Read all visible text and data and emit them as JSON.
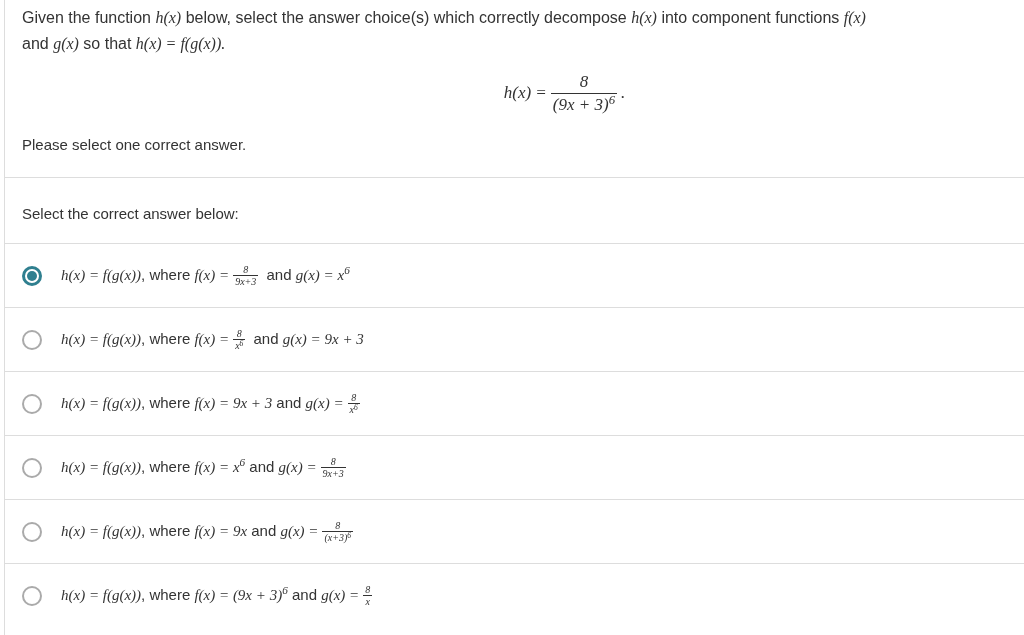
{
  "question": {
    "parts": [
      {
        "kind": "text",
        "text": "Given the function "
      },
      {
        "kind": "math",
        "text": "h(x)"
      },
      {
        "kind": "text",
        "text": " below, select the answer choice(s) which correctly decompose "
      },
      {
        "kind": "math",
        "text": "h(x)"
      },
      {
        "kind": "text",
        "text": " into component functions "
      },
      {
        "kind": "math",
        "text": "f(x)"
      },
      {
        "kind": "text",
        "text": " and "
      },
      {
        "kind": "math",
        "text": "g(x)"
      },
      {
        "kind": "text",
        "text": " so that "
      },
      {
        "kind": "math",
        "text": "h(x) = f(g(x))."
      }
    ]
  },
  "formula": {
    "parts": [
      {
        "kind": "math",
        "text": "h(x) ="
      },
      {
        "kind": "frac",
        "num": "8",
        "den": "(9x + 3)$^{6}$"
      },
      {
        "kind": "math",
        "text": "."
      }
    ]
  },
  "instruction": "Please select one correct answer.",
  "prompt": "Select the correct answer below:",
  "options": [
    {
      "selected": true,
      "parts": [
        {
          "kind": "math",
          "text": "h(x) = f(g(x))"
        },
        {
          "kind": "text",
          "text": ", where "
        },
        {
          "kind": "math",
          "text": "f(x) ="
        },
        {
          "kind": "frac",
          "num": "8",
          "den": "9x+3"
        },
        {
          "kind": "text",
          "text": " and "
        },
        {
          "kind": "math",
          "text": "g(x) = x$^{6}$"
        }
      ]
    },
    {
      "selected": false,
      "parts": [
        {
          "kind": "math",
          "text": "h(x) = f(g(x))"
        },
        {
          "kind": "text",
          "text": ", where "
        },
        {
          "kind": "math",
          "text": "f(x) ="
        },
        {
          "kind": "frac",
          "num": "8",
          "den": "x$^{6}$"
        },
        {
          "kind": "text",
          "text": " and "
        },
        {
          "kind": "math",
          "text": "g(x) = 9x + 3"
        }
      ]
    },
    {
      "selected": false,
      "parts": [
        {
          "kind": "math",
          "text": "h(x) = f(g(x))"
        },
        {
          "kind": "text",
          "text": ", where "
        },
        {
          "kind": "math",
          "text": "f(x) = 9x + 3"
        },
        {
          "kind": "text",
          "text": " and "
        },
        {
          "kind": "math",
          "text": "g(x) ="
        },
        {
          "kind": "frac",
          "num": "8",
          "den": "x$^{6}$"
        }
      ]
    },
    {
      "selected": false,
      "parts": [
        {
          "kind": "math",
          "text": "h(x) = f(g(x))"
        },
        {
          "kind": "text",
          "text": ", where "
        },
        {
          "kind": "math",
          "text": "f(x) = x$^{6}$"
        },
        {
          "kind": "text",
          "text": " and "
        },
        {
          "kind": "math",
          "text": "g(x) ="
        },
        {
          "kind": "frac",
          "num": "8",
          "den": "9x+3"
        }
      ]
    },
    {
      "selected": false,
      "parts": [
        {
          "kind": "math",
          "text": "h(x) = f(g(x))"
        },
        {
          "kind": "text",
          "text": ", where "
        },
        {
          "kind": "math",
          "text": "f(x) = 9x"
        },
        {
          "kind": "text",
          "text": " and "
        },
        {
          "kind": "math",
          "text": "g(x) ="
        },
        {
          "kind": "frac",
          "num": "8",
          "den": "(x+3)$^{6}$"
        }
      ]
    },
    {
      "selected": false,
      "parts": [
        {
          "kind": "math",
          "text": "h(x) = f(g(x))"
        },
        {
          "kind": "text",
          "text": ", where "
        },
        {
          "kind": "math",
          "text": "f(x) = (9x + 3)$^{6}$"
        },
        {
          "kind": "text",
          "text": " and "
        },
        {
          "kind": "math",
          "text": "g(x) ="
        },
        {
          "kind": "frac",
          "num": "8",
          "den": "x"
        }
      ]
    }
  ]
}
